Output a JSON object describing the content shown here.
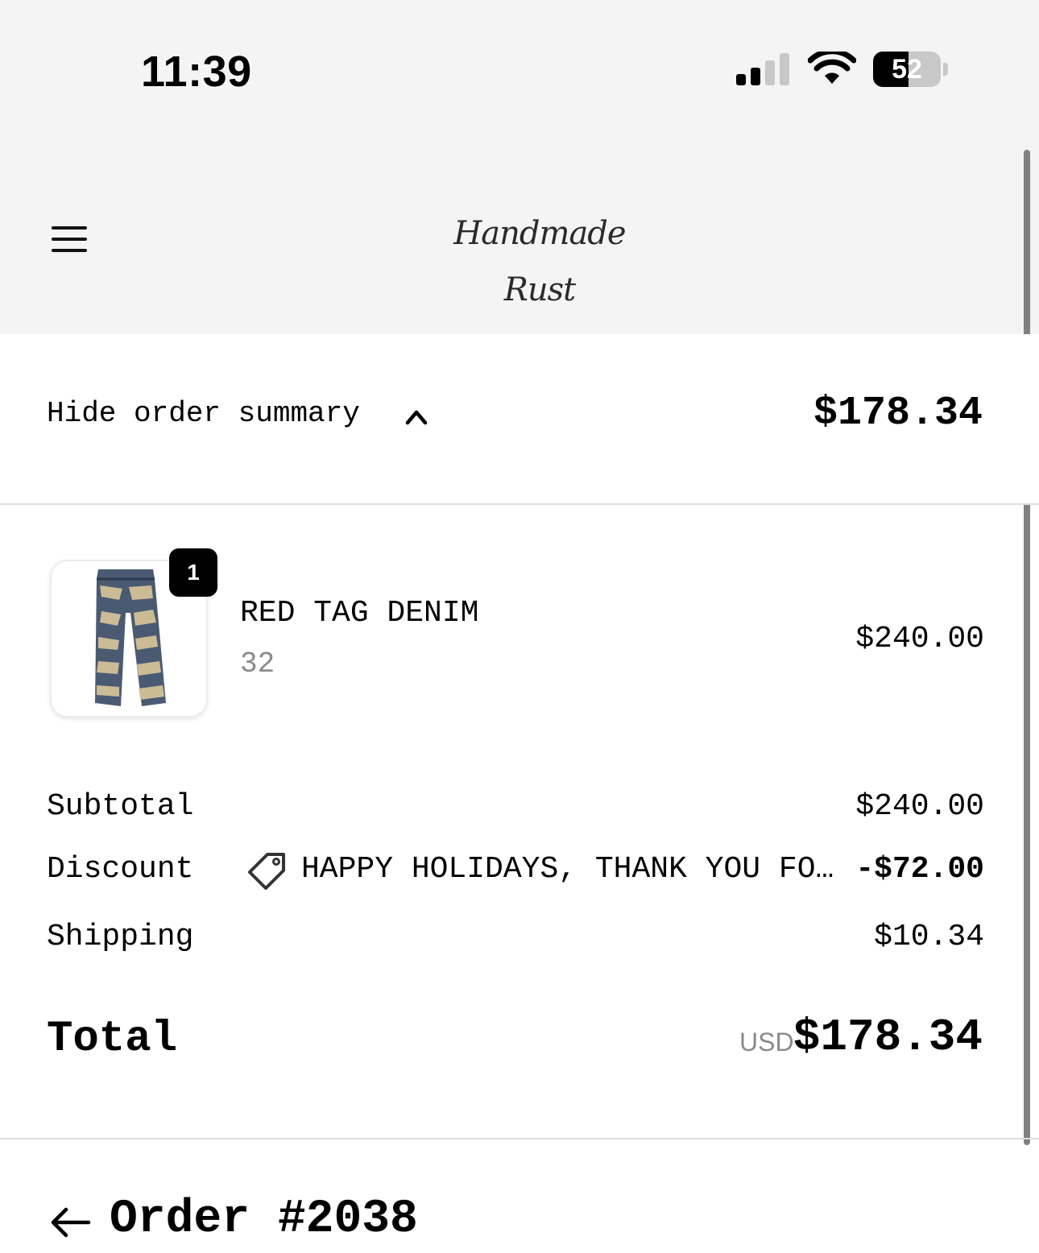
{
  "status_bar": {
    "time": "11:39",
    "battery_level": "52",
    "battery_percent": 52,
    "icons": [
      "cellular-signal-icon",
      "wifi-icon",
      "battery-icon"
    ]
  },
  "header": {
    "logo_text": "Handmade Rust",
    "menu_icon": "hamburger-menu-icon"
  },
  "summary_toggle": {
    "label": "Hide order summary",
    "icon": "chevron-up-icon",
    "total": "$178.34"
  },
  "line_items": [
    {
      "quantity": "1",
      "name": "RED TAG DENIM",
      "variant": "32",
      "price": "$240.00",
      "image_icon": "denim-jeans-image"
    }
  ],
  "costs": {
    "subtotal_label": "Subtotal",
    "subtotal_value": "$240.00",
    "discount_label": "Discount",
    "discount_code": "HAPPY HOLIDAYS, THANK YOU FO…",
    "discount_icon": "tag-icon",
    "discount_value": "-$72.00",
    "shipping_label": "Shipping",
    "shipping_value": "$10.34",
    "total_label": "Total",
    "currency": "USD",
    "total_value": "$178.34"
  },
  "order": {
    "title": "Order #2038",
    "back_icon": "arrow-left-icon"
  },
  "colors": {
    "header_bg": "#f4f4f4",
    "text": "#000000",
    "muted_text": "#8a8a8a",
    "divider": "#dedede"
  }
}
